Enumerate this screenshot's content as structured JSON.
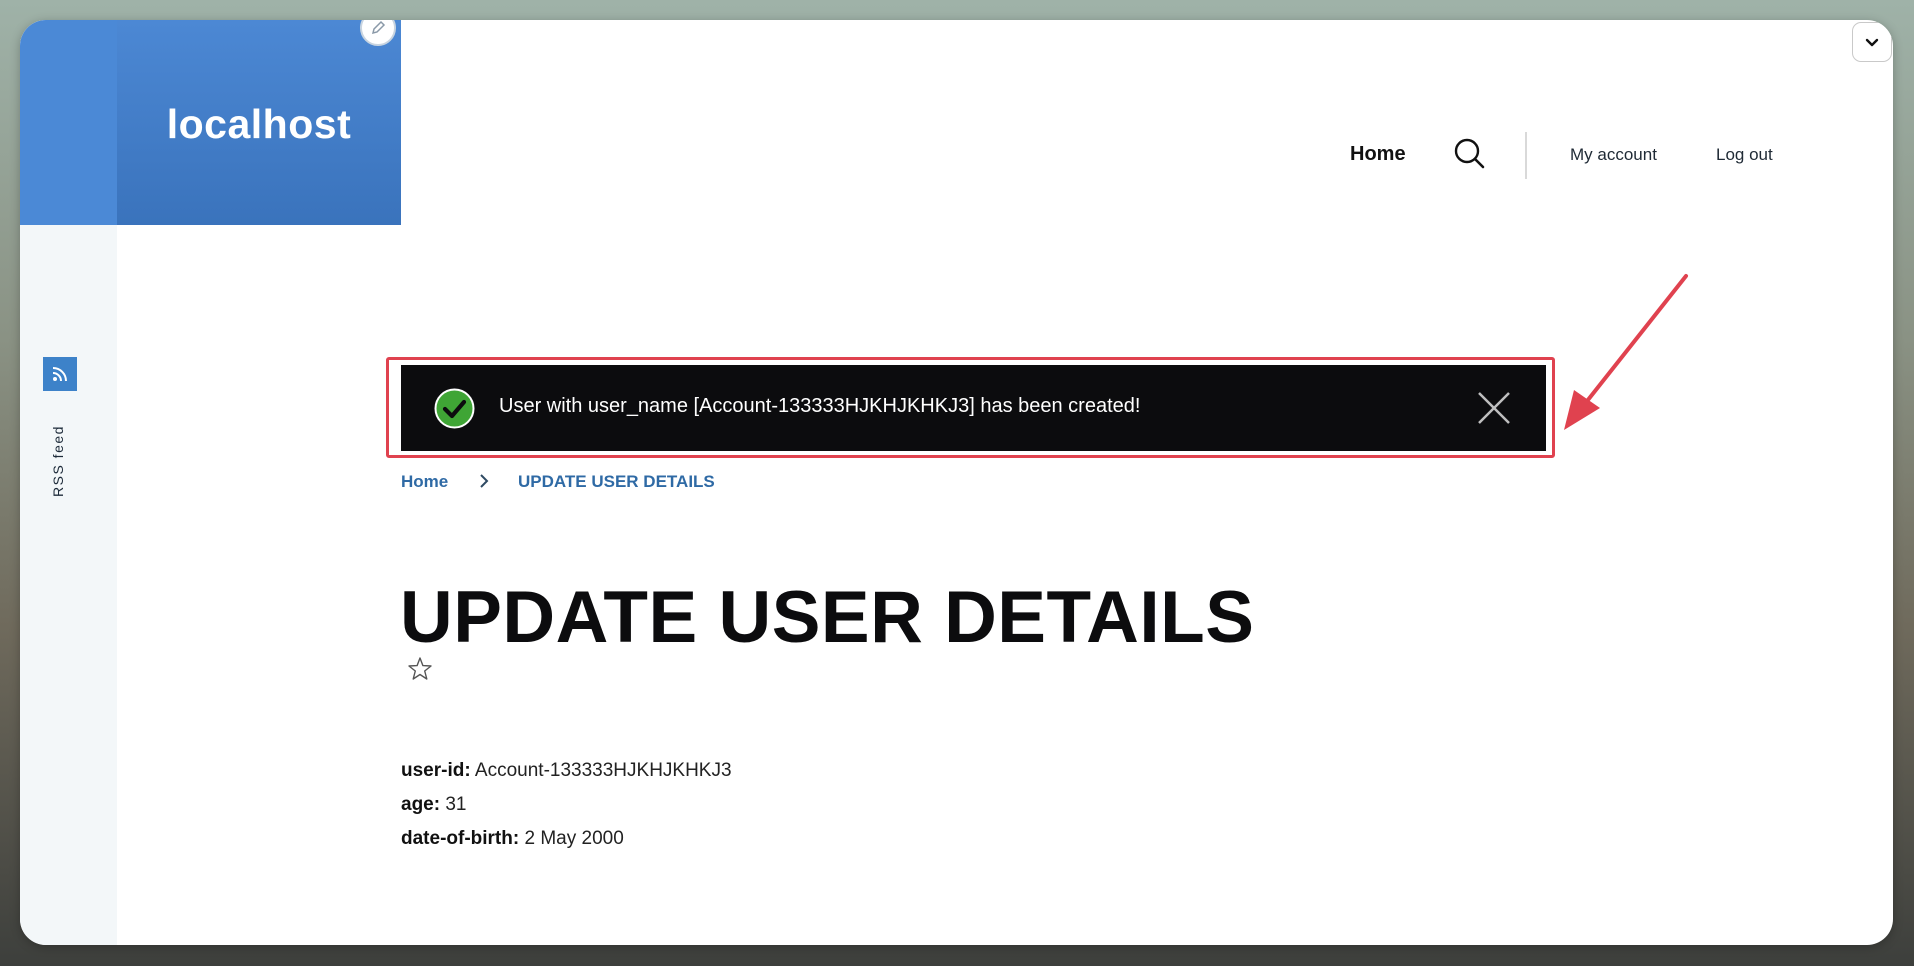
{
  "site": {
    "name": "localhost"
  },
  "sidebar": {
    "rss_label": "RSS feed",
    "rss_icon": "rss-icon"
  },
  "nav": {
    "home": "Home",
    "search_icon": "search-icon",
    "my_account": "My account",
    "log_out": "Log out"
  },
  "toast": {
    "message": "User with user_name [Account-133333HJKHJKHKJ3] has been created!",
    "status_color": "#3fa535"
  },
  "breadcrumb": {
    "home": "Home",
    "current": "UPDATE USER DETAILS"
  },
  "page": {
    "title": "UPDATE USER DETAILS"
  },
  "details": [
    {
      "key": "user-id:",
      "value": "Account-133333HJKHJKHKJ3"
    },
    {
      "key": "age:",
      "value": "31"
    },
    {
      "key": "date-of-birth:",
      "value": "2 May 2000"
    }
  ],
  "colors": {
    "brand_blue": "#3f7cc8",
    "annotation_red": "#e0424f",
    "link_blue": "#2f6aa5"
  }
}
